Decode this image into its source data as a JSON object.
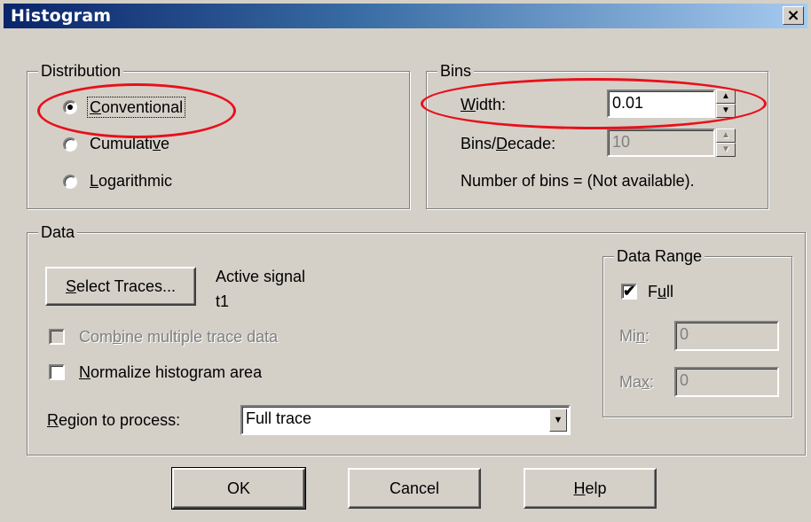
{
  "window": {
    "title": "Histogram",
    "close_glyph": "×"
  },
  "distribution": {
    "legend": "Distribution",
    "options": [
      {
        "label": "Conventional",
        "selected": true
      },
      {
        "label": "Cumulative",
        "selected": false
      },
      {
        "label": "Logarithmic",
        "selected": false
      }
    ]
  },
  "bins": {
    "legend": "Bins",
    "width_label": "Width:",
    "width_value": "0.01",
    "bins_per_decade_label": "Bins/Decade:",
    "bins_per_decade_value": "10",
    "count_text": "Number of bins = (Not available)."
  },
  "data": {
    "legend": "Data",
    "select_traces_label": "Select Traces...",
    "active_signal_label": "Active signal",
    "active_signal_value": "t1",
    "combine_label": "Combine multiple trace data",
    "normalize_label": "Normalize histogram area",
    "region_label": "Region to process:",
    "region_value": "Full trace",
    "range": {
      "legend": "Data Range",
      "full_label": "Full",
      "full_checked": true,
      "min_label": "Min:",
      "min_value": "0",
      "max_label": "Max:",
      "max_value": "0"
    }
  },
  "buttons": {
    "ok": "OK",
    "cancel": "Cancel",
    "help": "Help"
  },
  "colors": {
    "highlight_ellipse": "#e8101a",
    "title_bar": "#0a246a",
    "face": "#d4d0c8"
  }
}
